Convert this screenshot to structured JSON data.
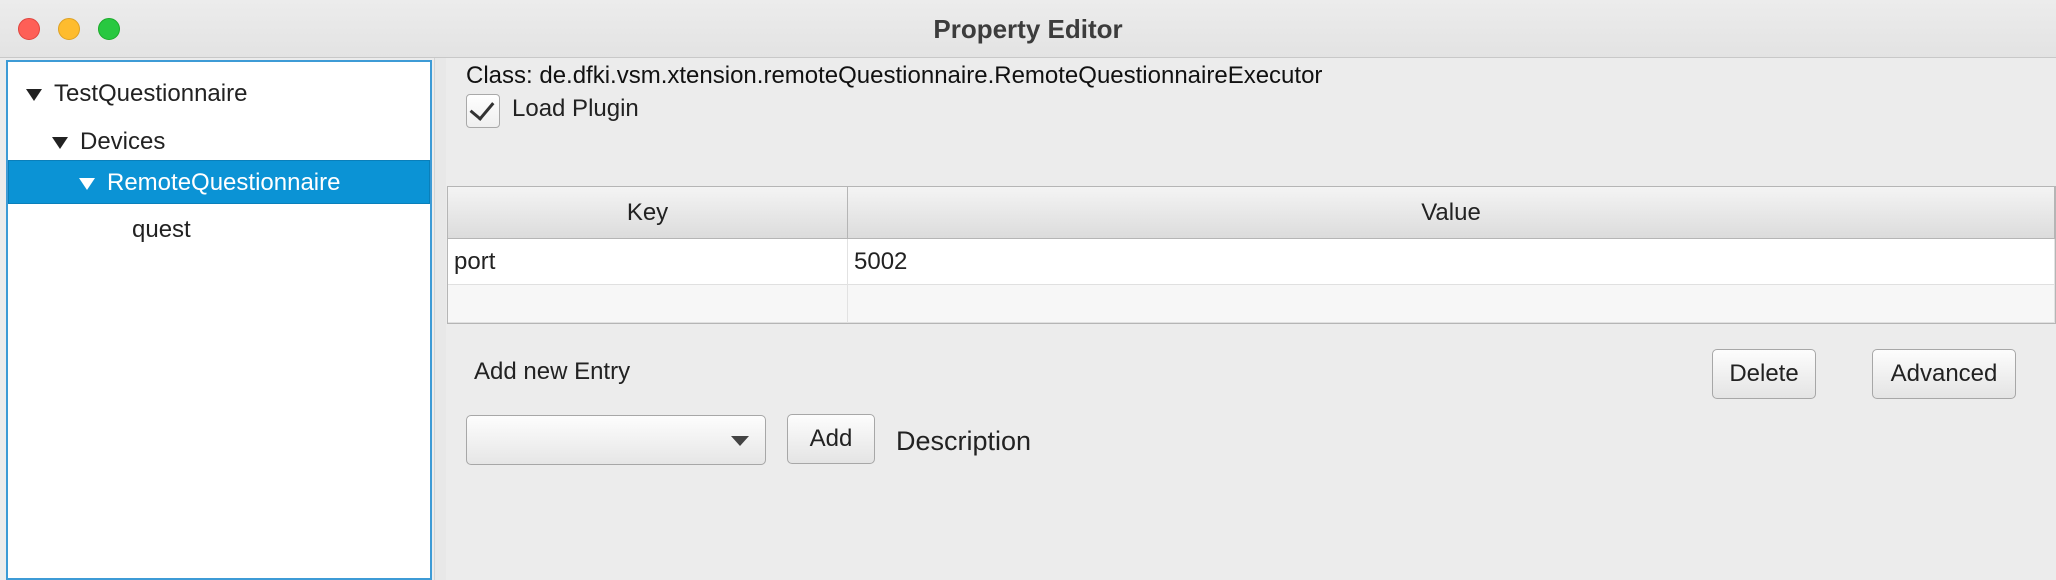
{
  "window": {
    "title": "Property Editor"
  },
  "tree": {
    "items": [
      {
        "label": "TestQuestionnaire",
        "expanded": true,
        "selected": false
      },
      {
        "label": "Devices",
        "expanded": true,
        "selected": false
      },
      {
        "label": "RemoteQuestionnaire",
        "expanded": true,
        "selected": true
      },
      {
        "label": "quest",
        "expanded": false,
        "selected": false
      }
    ]
  },
  "details": {
    "class_text": "Class: de.dfki.vsm.xtension.remoteQuestionnaire.RemoteQuestionnaireExecutor",
    "load_plugin_label": "Load Plugin",
    "load_plugin_checked": true
  },
  "table": {
    "columns": [
      "Key",
      "Value"
    ],
    "rows": [
      {
        "key": "port",
        "value": "5002"
      },
      {
        "key": "",
        "value": ""
      }
    ]
  },
  "entry": {
    "add_new_entry_label": "Add new Entry",
    "delete_label": "Delete",
    "advanced_label": "Advanced",
    "combo_value": "",
    "add_label": "Add",
    "description_label": "Description"
  },
  "colors": {
    "selection": "#0b93d5",
    "tree_border": "#3d9bd6",
    "close": "#fe5f57",
    "minimize": "#febc2e",
    "maximize": "#28c840"
  }
}
